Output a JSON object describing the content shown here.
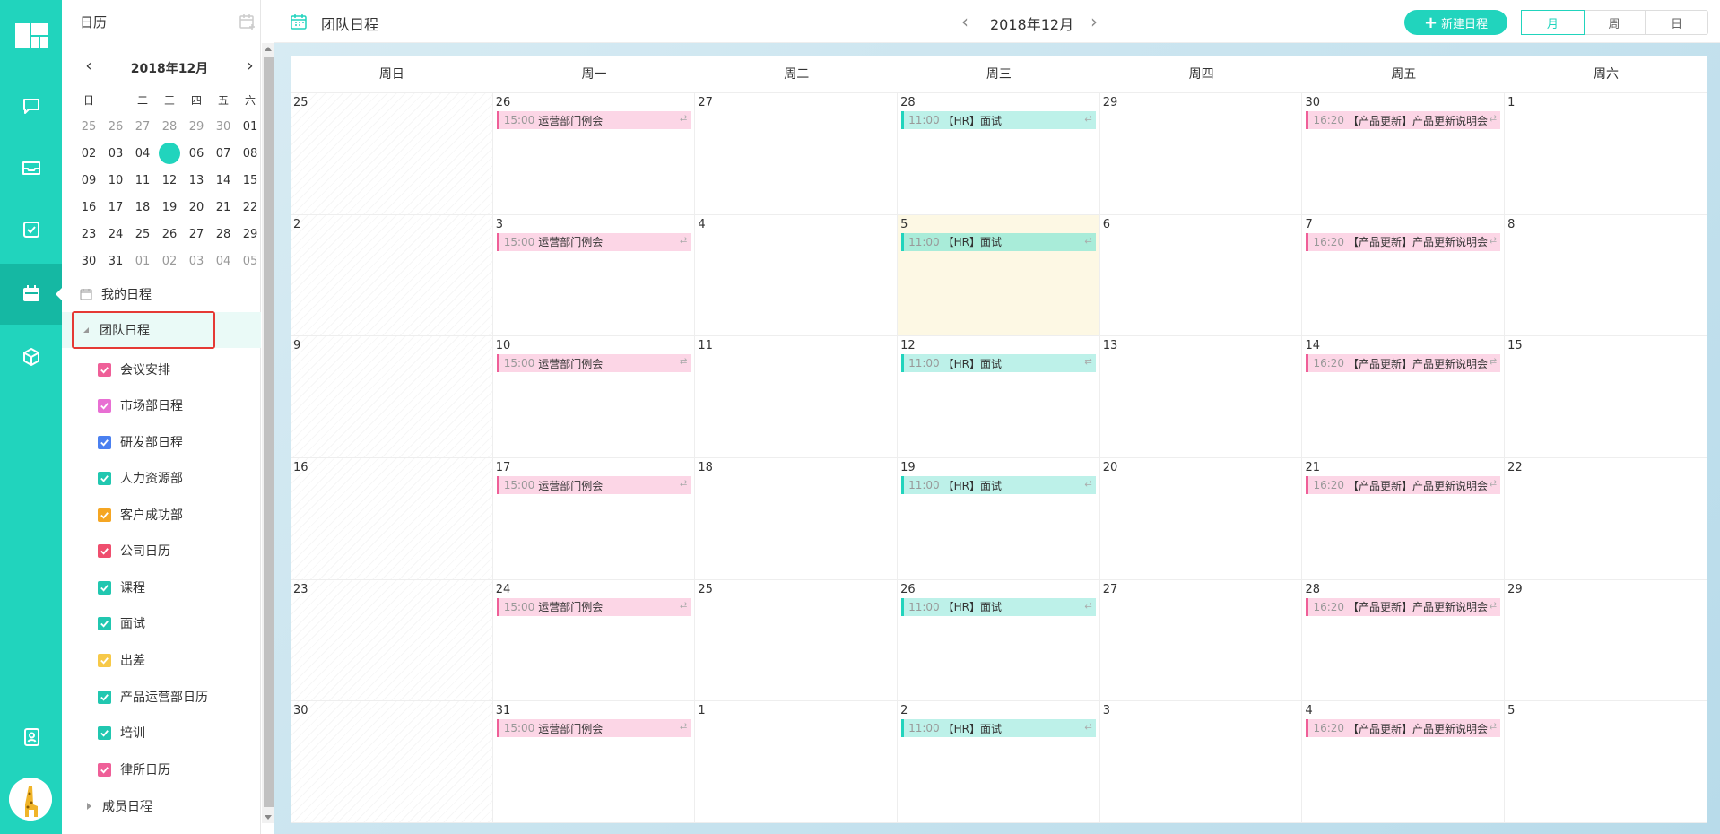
{
  "sidebar": {
    "title": "日历",
    "mini_calendar": {
      "title": "2018年12月",
      "prev": "‹",
      "next": "›",
      "weekdays": [
        "日",
        "一",
        "二",
        "三",
        "四",
        "五",
        "六"
      ],
      "weeks": [
        [
          "25",
          "26",
          "27",
          "28",
          "29",
          "30",
          "01"
        ],
        [
          "02",
          "03",
          "04",
          "05",
          "06",
          "07",
          "08"
        ],
        [
          "09",
          "10",
          "11",
          "12",
          "13",
          "14",
          "15"
        ],
        [
          "16",
          "17",
          "18",
          "19",
          "20",
          "21",
          "22"
        ],
        [
          "23",
          "24",
          "25",
          "26",
          "27",
          "28",
          "29"
        ],
        [
          "30",
          "31",
          "01",
          "02",
          "03",
          "04",
          "05"
        ]
      ]
    },
    "my_schedule": "我的日程",
    "team_schedule": "团队日程",
    "member_schedule": "成员日程",
    "calendars": [
      {
        "label": "会议安排",
        "color": "#ef5f98"
      },
      {
        "label": "市场部日程",
        "color": "#e86fd3"
      },
      {
        "label": "研发部日程",
        "color": "#4a80f0"
      },
      {
        "label": "人力资源部",
        "color": "#21c7b0"
      },
      {
        "label": "客户成功部",
        "color": "#f5a623"
      },
      {
        "label": "公司日历",
        "color": "#ef4e6e"
      },
      {
        "label": "课程",
        "color": "#21c7b0"
      },
      {
        "label": "面试",
        "color": "#21c7b0"
      },
      {
        "label": "出差",
        "color": "#f7c948"
      },
      {
        "label": "产品运营部日历",
        "color": "#21c7b0"
      },
      {
        "label": "培训",
        "color": "#21c7b0"
      },
      {
        "label": "律所日历",
        "color": "#ef5f98"
      }
    ]
  },
  "header": {
    "title": "团队日程",
    "month": "2018年12月",
    "prev": "‹",
    "next": "›",
    "new_button": "新建日程",
    "views": [
      "月",
      "周",
      "日"
    ],
    "active_view": "月"
  },
  "calendar": {
    "weekdays": [
      "周日",
      "周一",
      "周二",
      "周三",
      "周四",
      "周五",
      "周六"
    ],
    "weeks": [
      [
        "25",
        "26",
        "27",
        "28",
        "29",
        "30",
        "1"
      ],
      [
        "2",
        "3",
        "4",
        "5",
        "6",
        "7",
        "8"
      ],
      [
        "9",
        "10",
        "11",
        "12",
        "13",
        "14",
        "15"
      ],
      [
        "16",
        "17",
        "18",
        "19",
        "20",
        "21",
        "22"
      ],
      [
        "23",
        "24",
        "25",
        "26",
        "27",
        "28",
        "29"
      ],
      [
        "30",
        "31",
        "1",
        "2",
        "3",
        "4",
        "5"
      ]
    ],
    "events": {
      "monday": {
        "time": "15:00",
        "text": "运营部门例会",
        "repeat": "⇄"
      },
      "wednesday": {
        "time": "11:00",
        "text": "【HR】面试",
        "repeat": "⇄"
      },
      "friday": {
        "time": "16:20",
        "text": "【产品更新】产品更新说明会",
        "repeat": "⇄"
      }
    }
  }
}
